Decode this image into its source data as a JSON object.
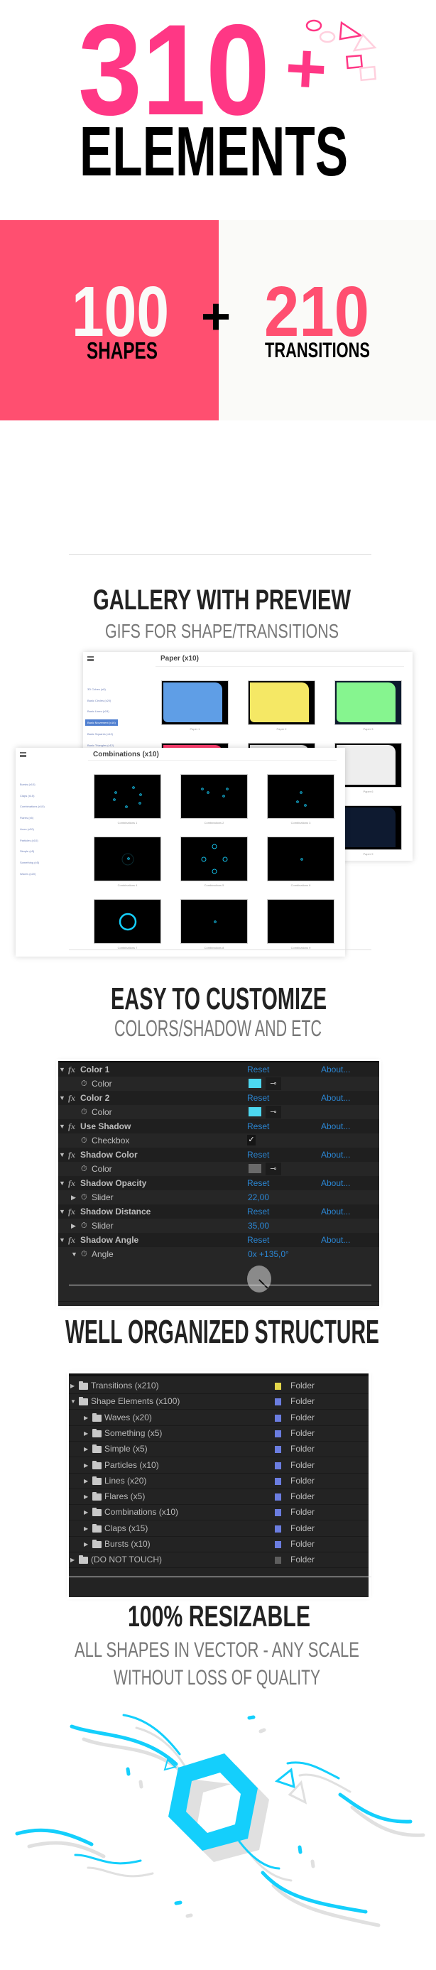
{
  "colors": {
    "hero_pink": "#ff3785",
    "block_pink": "#ff4f70",
    "block_light": "#fafaf8",
    "heading": "#222222",
    "subheading": "#777777",
    "accent_cyan": "#14cffc",
    "ae_blue": "#2b86d3"
  },
  "hero": {
    "count": "310",
    "plus": "+",
    "label": "ELEMENTS"
  },
  "split": {
    "shapes_count": "100",
    "shapes_label": "SHAPES",
    "plus": "+",
    "transitions_count": "210",
    "transitions_label": "TRANSITIONS"
  },
  "gallery": {
    "title": "GALLERY WITH PREVIEW",
    "subtitle": "GIFS FOR SHAPE/TRANSITIONS",
    "back_window": {
      "title": "Paper (x10)",
      "sidebar": [
        "3D Cubes (x8)",
        "Basic Circles (x20)",
        "Basic Lines (x24)",
        "Basic Movement (x16)",
        "Basic Squares (x12)",
        "Basic Triangles (x12)"
      ],
      "active_index": 3,
      "thumbs": [
        {
          "label": "Paper 1",
          "color": "#5f9ee6"
        },
        {
          "label": "Paper 2",
          "color": "#f5e865"
        },
        {
          "label": "Paper 3",
          "color": "#86f58f"
        },
        {
          "label": "",
          "color": "#ff3d6e"
        },
        {
          "label": "",
          "color": "#dddddd"
        },
        {
          "label": "Paper 6",
          "color": "#eeeeee"
        },
        {
          "label": "",
          "color": "#000000"
        },
        {
          "label": "",
          "color": "#000000"
        },
        {
          "label": "Paper 9",
          "color": "#0e1a30"
        }
      ]
    },
    "front_window": {
      "title": "Combinations (x10)",
      "sidebar": [
        "Bursts (x10)",
        "Claps (x15)",
        "Combinations (x10)",
        "Flares (x5)",
        "Lines (x20)",
        "Particles (x10)",
        "Simple (x5)",
        "Something (x5)",
        "Waves (x20)"
      ],
      "thumbs": [
        "Combinations 1",
        "Combinations 2",
        "Combinations 3",
        "Combinations 4",
        "Combinations 5",
        "Combinations 6",
        "Combinations 7",
        "Combinations 8",
        "Combinations 9"
      ]
    }
  },
  "customize": {
    "title": "EASY TO CUSTOMIZE",
    "subtitle": "COLORS/SHADOW AND ETC",
    "reset_label": "Reset",
    "about_label": "About...",
    "effects": [
      {
        "name": "Color 1",
        "param": "Color",
        "kind": "color",
        "value": "#4dd8f0"
      },
      {
        "name": "Color 2",
        "param": "Color",
        "kind": "color",
        "value": "#4dd8f0"
      },
      {
        "name": "Use Shadow",
        "param": "Checkbox",
        "kind": "checkbox",
        "value": "✓"
      },
      {
        "name": "Shadow Color",
        "param": "Color",
        "kind": "color",
        "value": "#6a6a6a"
      },
      {
        "name": "Shadow Opacity",
        "param": "Slider",
        "kind": "slider",
        "value": "22,00"
      },
      {
        "name": "Shadow Distance",
        "param": "Slider",
        "kind": "slider",
        "value": "35,00"
      },
      {
        "name": "Shadow Angle",
        "param": "Angle",
        "kind": "angle",
        "value": "0x +135,0°",
        "angle_deg": 135
      }
    ]
  },
  "structure": {
    "title": "WELL ORGANIZED STRUCTURE",
    "folders": [
      {
        "name": "Transitions (x210)",
        "level": 0,
        "expanded": false,
        "color": "#e3d64a",
        "type": "Folder"
      },
      {
        "name": "Shape Elements (x100)",
        "level": 0,
        "expanded": true,
        "color": "#6b7de0",
        "type": "Folder"
      },
      {
        "name": "Waves (x20)",
        "level": 1,
        "expanded": false,
        "color": "#6b7de0",
        "type": "Folder"
      },
      {
        "name": "Something (x5)",
        "level": 1,
        "expanded": false,
        "color": "#6b7de0",
        "type": "Folder"
      },
      {
        "name": "Simple (x5)",
        "level": 1,
        "expanded": false,
        "color": "#6b7de0",
        "type": "Folder"
      },
      {
        "name": "Particles (x10)",
        "level": 1,
        "expanded": false,
        "color": "#6b7de0",
        "type": "Folder"
      },
      {
        "name": "Lines (x20)",
        "level": 1,
        "expanded": false,
        "color": "#6b7de0",
        "type": "Folder"
      },
      {
        "name": "Flares (x5)",
        "level": 1,
        "expanded": false,
        "color": "#6b7de0",
        "type": "Folder"
      },
      {
        "name": "Combinations (x10)",
        "level": 1,
        "expanded": false,
        "color": "#6b7de0",
        "type": "Folder"
      },
      {
        "name": "Claps (x15)",
        "level": 1,
        "expanded": false,
        "color": "#6b7de0",
        "type": "Folder"
      },
      {
        "name": "Bursts (x10)",
        "level": 1,
        "expanded": false,
        "color": "#6b7de0",
        "type": "Folder"
      },
      {
        "name": "(DO NOT TOUCH)",
        "level": 0,
        "expanded": false,
        "color": "#5e5e5e",
        "type": "Folder"
      }
    ]
  },
  "resizable": {
    "title": "100% RESIZABLE",
    "subtitle_lines": [
      "ALL SHAPES IN VECTOR - ANY SCALE",
      "WITHOUT LOSS OF QUALITY"
    ]
  }
}
